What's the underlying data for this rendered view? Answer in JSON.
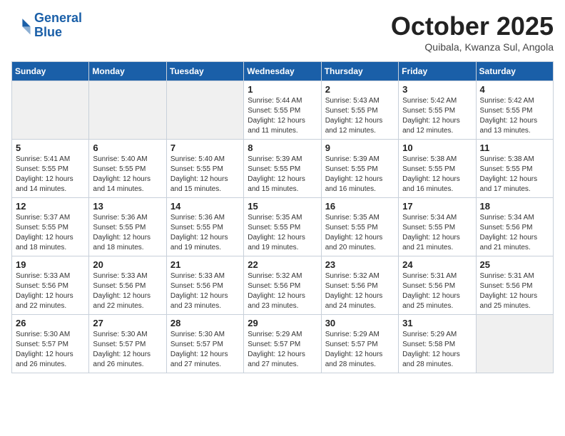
{
  "header": {
    "logo_line1": "General",
    "logo_line2": "Blue",
    "month": "October 2025",
    "location": "Quibala, Kwanza Sul, Angola"
  },
  "weekdays": [
    "Sunday",
    "Monday",
    "Tuesday",
    "Wednesday",
    "Thursday",
    "Friday",
    "Saturday"
  ],
  "weeks": [
    [
      {
        "day": "",
        "info": ""
      },
      {
        "day": "",
        "info": ""
      },
      {
        "day": "",
        "info": ""
      },
      {
        "day": "1",
        "info": "Sunrise: 5:44 AM\nSunset: 5:55 PM\nDaylight: 12 hours\nand 11 minutes."
      },
      {
        "day": "2",
        "info": "Sunrise: 5:43 AM\nSunset: 5:55 PM\nDaylight: 12 hours\nand 12 minutes."
      },
      {
        "day": "3",
        "info": "Sunrise: 5:42 AM\nSunset: 5:55 PM\nDaylight: 12 hours\nand 12 minutes."
      },
      {
        "day": "4",
        "info": "Sunrise: 5:42 AM\nSunset: 5:55 PM\nDaylight: 12 hours\nand 13 minutes."
      }
    ],
    [
      {
        "day": "5",
        "info": "Sunrise: 5:41 AM\nSunset: 5:55 PM\nDaylight: 12 hours\nand 14 minutes."
      },
      {
        "day": "6",
        "info": "Sunrise: 5:40 AM\nSunset: 5:55 PM\nDaylight: 12 hours\nand 14 minutes."
      },
      {
        "day": "7",
        "info": "Sunrise: 5:40 AM\nSunset: 5:55 PM\nDaylight: 12 hours\nand 15 minutes."
      },
      {
        "day": "8",
        "info": "Sunrise: 5:39 AM\nSunset: 5:55 PM\nDaylight: 12 hours\nand 15 minutes."
      },
      {
        "day": "9",
        "info": "Sunrise: 5:39 AM\nSunset: 5:55 PM\nDaylight: 12 hours\nand 16 minutes."
      },
      {
        "day": "10",
        "info": "Sunrise: 5:38 AM\nSunset: 5:55 PM\nDaylight: 12 hours\nand 16 minutes."
      },
      {
        "day": "11",
        "info": "Sunrise: 5:38 AM\nSunset: 5:55 PM\nDaylight: 12 hours\nand 17 minutes."
      }
    ],
    [
      {
        "day": "12",
        "info": "Sunrise: 5:37 AM\nSunset: 5:55 PM\nDaylight: 12 hours\nand 18 minutes."
      },
      {
        "day": "13",
        "info": "Sunrise: 5:36 AM\nSunset: 5:55 PM\nDaylight: 12 hours\nand 18 minutes."
      },
      {
        "day": "14",
        "info": "Sunrise: 5:36 AM\nSunset: 5:55 PM\nDaylight: 12 hours\nand 19 minutes."
      },
      {
        "day": "15",
        "info": "Sunrise: 5:35 AM\nSunset: 5:55 PM\nDaylight: 12 hours\nand 19 minutes."
      },
      {
        "day": "16",
        "info": "Sunrise: 5:35 AM\nSunset: 5:55 PM\nDaylight: 12 hours\nand 20 minutes."
      },
      {
        "day": "17",
        "info": "Sunrise: 5:34 AM\nSunset: 5:55 PM\nDaylight: 12 hours\nand 21 minutes."
      },
      {
        "day": "18",
        "info": "Sunrise: 5:34 AM\nSunset: 5:56 PM\nDaylight: 12 hours\nand 21 minutes."
      }
    ],
    [
      {
        "day": "19",
        "info": "Sunrise: 5:33 AM\nSunset: 5:56 PM\nDaylight: 12 hours\nand 22 minutes."
      },
      {
        "day": "20",
        "info": "Sunrise: 5:33 AM\nSunset: 5:56 PM\nDaylight: 12 hours\nand 22 minutes."
      },
      {
        "day": "21",
        "info": "Sunrise: 5:33 AM\nSunset: 5:56 PM\nDaylight: 12 hours\nand 23 minutes."
      },
      {
        "day": "22",
        "info": "Sunrise: 5:32 AM\nSunset: 5:56 PM\nDaylight: 12 hours\nand 23 minutes."
      },
      {
        "day": "23",
        "info": "Sunrise: 5:32 AM\nSunset: 5:56 PM\nDaylight: 12 hours\nand 24 minutes."
      },
      {
        "day": "24",
        "info": "Sunrise: 5:31 AM\nSunset: 5:56 PM\nDaylight: 12 hours\nand 25 minutes."
      },
      {
        "day": "25",
        "info": "Sunrise: 5:31 AM\nSunset: 5:56 PM\nDaylight: 12 hours\nand 25 minutes."
      }
    ],
    [
      {
        "day": "26",
        "info": "Sunrise: 5:30 AM\nSunset: 5:57 PM\nDaylight: 12 hours\nand 26 minutes."
      },
      {
        "day": "27",
        "info": "Sunrise: 5:30 AM\nSunset: 5:57 PM\nDaylight: 12 hours\nand 26 minutes."
      },
      {
        "day": "28",
        "info": "Sunrise: 5:30 AM\nSunset: 5:57 PM\nDaylight: 12 hours\nand 27 minutes."
      },
      {
        "day": "29",
        "info": "Sunrise: 5:29 AM\nSunset: 5:57 PM\nDaylight: 12 hours\nand 27 minutes."
      },
      {
        "day": "30",
        "info": "Sunrise: 5:29 AM\nSunset: 5:57 PM\nDaylight: 12 hours\nand 28 minutes."
      },
      {
        "day": "31",
        "info": "Sunrise: 5:29 AM\nSunset: 5:58 PM\nDaylight: 12 hours\nand 28 minutes."
      },
      {
        "day": "",
        "info": ""
      }
    ]
  ]
}
